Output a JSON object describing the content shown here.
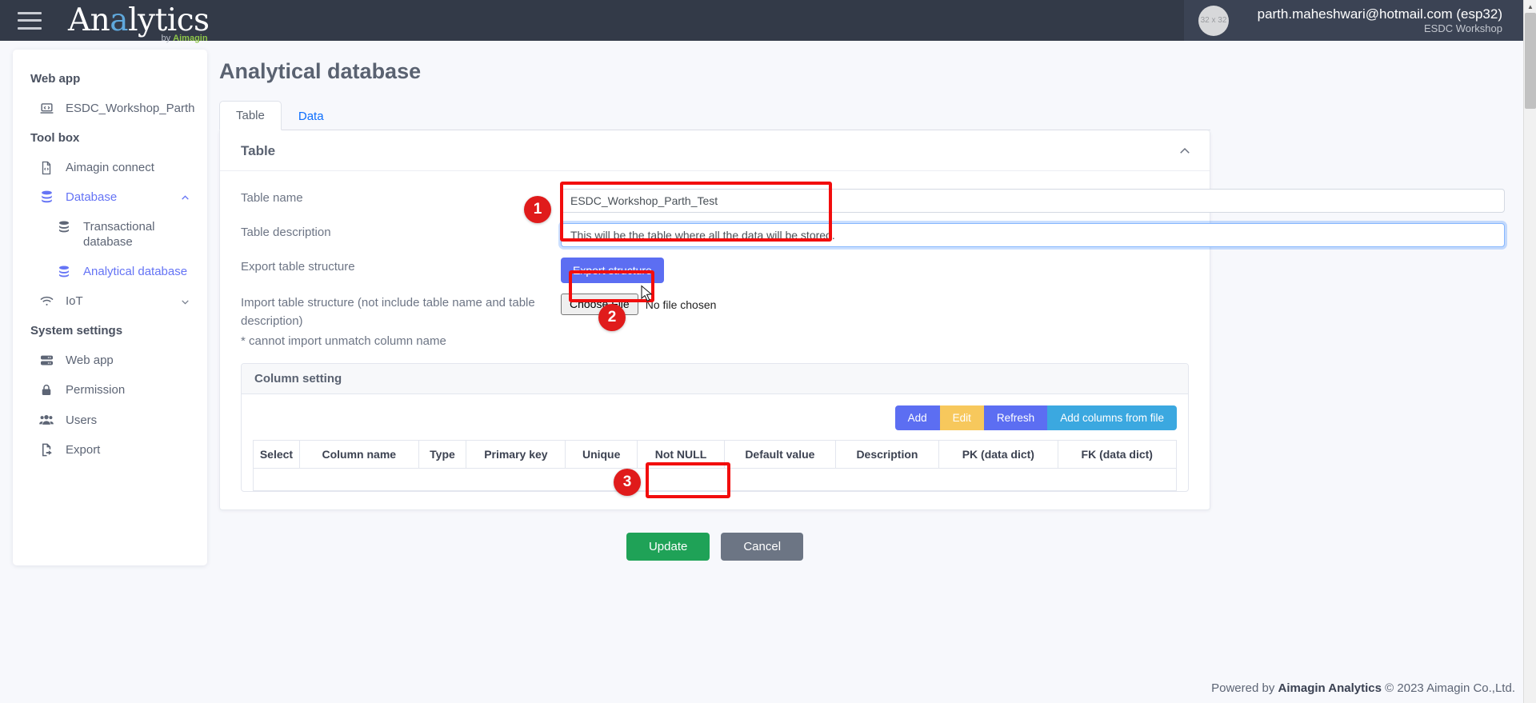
{
  "topbar": {
    "menu_icon": "hamburger-icon",
    "brand_prefix": "An",
    "brand_highlight": "a",
    "brand_suffix": "lytics",
    "brand_sub_by": "by ",
    "brand_sub_name": "Aimagin",
    "avatar_placeholder": "32 x 32",
    "user_email": "parth.maheshwari@hotmail.com (esp32)",
    "user_org": "ESDC Workshop"
  },
  "sidebar": {
    "groups": [
      {
        "title": "Web app",
        "items": [
          {
            "label": "ESDC_Workshop_Parth",
            "icon": "laptop-code-icon",
            "active": false
          }
        ]
      },
      {
        "title": "Tool box",
        "items": [
          {
            "label": "Aimagin connect",
            "icon": "file-code-icon",
            "active": false
          },
          {
            "label": "Database",
            "icon": "database-icon",
            "active": true,
            "chevron": "chevron-up"
          },
          {
            "label": "Transactional database",
            "icon": "database-icon",
            "sub": true,
            "active": false
          },
          {
            "label": "Analytical database",
            "icon": "database-icon",
            "sub": true,
            "active": true
          },
          {
            "label": "IoT",
            "icon": "wifi-icon",
            "active": false,
            "chevron": "chevron-down"
          }
        ]
      },
      {
        "title": "System settings",
        "items": [
          {
            "label": "Web app",
            "icon": "server-icon",
            "active": false
          },
          {
            "label": "Permission",
            "icon": "lock-icon",
            "active": false
          },
          {
            "label": "Users",
            "icon": "users-icon",
            "active": false
          },
          {
            "label": "Export",
            "icon": "file-export-icon",
            "active": false
          }
        ]
      }
    ]
  },
  "main": {
    "page_title": "Analytical database",
    "tabs": [
      {
        "label": "Table",
        "active": true
      },
      {
        "label": "Data",
        "active": false
      }
    ],
    "panel": {
      "title": "Table",
      "collapse_icon": "chevron-up-icon",
      "fields": {
        "table_name_label": "Table name",
        "table_name_value": "ESDC_Workshop_Parth_Test",
        "table_description_label": "Table description",
        "table_description_value": "This will be the table where all the data will be stored.",
        "export_label": "Export table structure",
        "export_button": "Export structure",
        "import_label_line1": "Import table structure (not include table name and table",
        "import_label_line2": "description)",
        "import_label_line3": "* cannot import unmatch column name",
        "choose_file_button": "Choose File",
        "chosen_file_text": "No file chosen"
      },
      "column_setting": {
        "title": "Column setting",
        "buttons": [
          {
            "label": "Add",
            "color": "#5c6ef2"
          },
          {
            "label": "Edit",
            "color": "#f7c85c"
          },
          {
            "label": "Refresh",
            "color": "#5c6ef2"
          },
          {
            "label": "Add columns from file",
            "color": "#3ba8e0"
          }
        ],
        "headers": [
          "Select",
          "Column name",
          "Type",
          "Primary key",
          "Unique",
          "Not NULL",
          "Default value",
          "Description",
          "PK (data dict)",
          "FK (data dict)"
        ],
        "rows": []
      }
    },
    "actions": {
      "update_button": "Update",
      "cancel_button": "Cancel"
    }
  },
  "annotations": {
    "step1": "1",
    "step2": "2",
    "step3": "3"
  },
  "footer": {
    "powered_prefix": "Powered by ",
    "brand": "Aimagin Analytics",
    "copyright": " © 2023 Aimagin Co.,Ltd."
  },
  "colors": {
    "accent": "#5c6ef2",
    "topbar": "#333a48",
    "highlight_red": "#f20d0d",
    "success_green": "#1fa257"
  }
}
